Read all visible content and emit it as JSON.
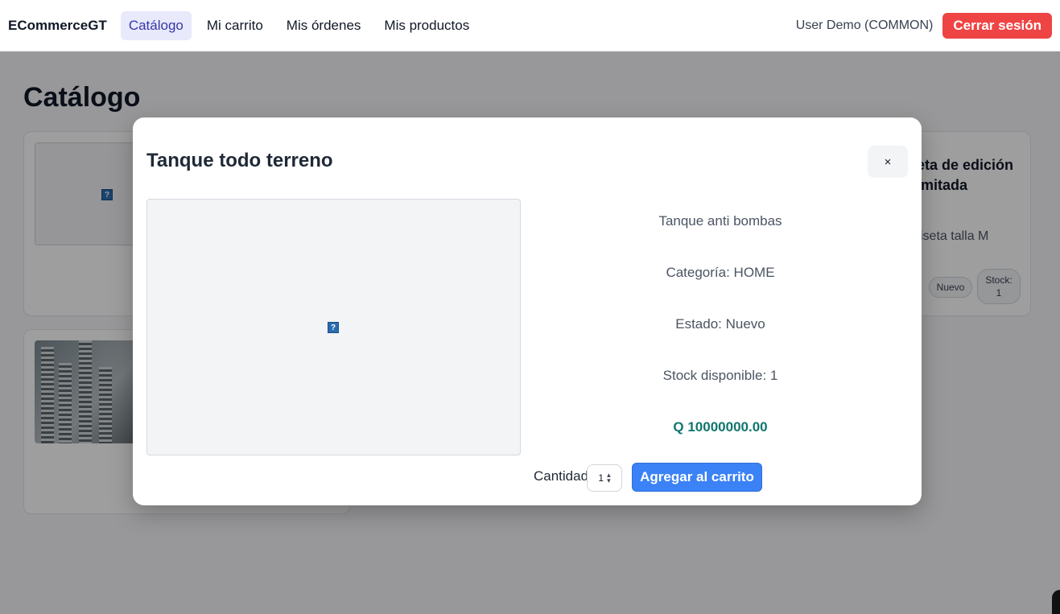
{
  "navbar": {
    "brand": "ECommerceGT",
    "links": [
      {
        "label": "Catálogo",
        "active": true
      },
      {
        "label": "Mi carrito",
        "active": false
      },
      {
        "label": "Mis órdenes",
        "active": false
      },
      {
        "label": "Mis productos",
        "active": false
      }
    ],
    "user": "User Demo (COMMON)",
    "logout_label": "Cerrar sesión"
  },
  "page": {
    "title": "Catálogo",
    "right_card": {
      "title_line1": "eta de edición",
      "title_line2": "imitada",
      "description": "iseta talla M",
      "badge_estado": "Nuevo",
      "badge_stock_label": "Stock:",
      "badge_stock_value": "1"
    }
  },
  "modal": {
    "title": "Tanque todo terreno",
    "close_label": "×",
    "description": "Tanque anti bombas",
    "category": "Categoría: HOME",
    "state": "Estado: Nuevo",
    "stock": "Stock disponible: 1",
    "price": "Q 10000000.00",
    "quantity_label": "Cantidad",
    "quantity_value": "1",
    "add_button_label": "Agregar al carrito",
    "broken_image_glyph": "?"
  },
  "colors": {
    "logout": "#ef4444",
    "add_button": "#3b82f6",
    "price": "#0f766e",
    "active_nav_bg": "#e8e9fb",
    "active_nav_text": "#3a36a8"
  }
}
